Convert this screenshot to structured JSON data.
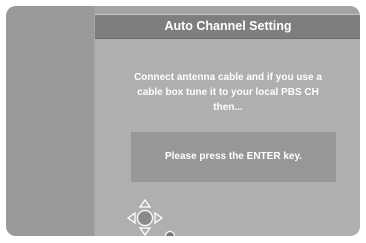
{
  "dialog": {
    "title": "Auto Channel Setting",
    "message_lines": [
      "Connect antenna cable and if you use a",
      "cable box tune it to your local PBS CH",
      "then..."
    ],
    "prompt": "Please press the ENTER key."
  },
  "icons": {
    "navigation_pad": "dpad-enter-icon",
    "secondary_button": "round-button-icon"
  },
  "colors": {
    "background": "#a4a4a4",
    "title_bar": "#7e7e7e",
    "prompt_box": "#979797",
    "text": "#ffffff"
  }
}
